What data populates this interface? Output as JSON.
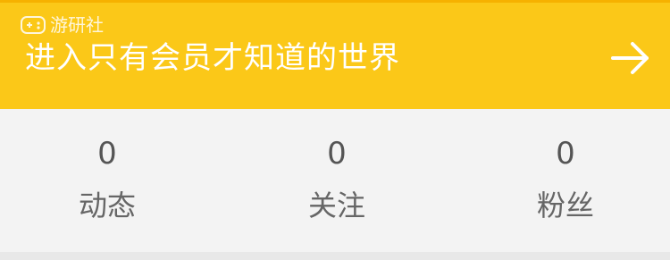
{
  "watermark": {
    "text": "游研社"
  },
  "banner": {
    "text": "进入只有会员才知道的世界",
    "icon": "arrow-right-icon",
    "background_color": "#fbc818",
    "text_color": "#ffffff"
  },
  "stats": [
    {
      "value": "0",
      "label": "动态"
    },
    {
      "value": "0",
      "label": "关注"
    },
    {
      "value": "0",
      "label": "粉丝"
    }
  ]
}
